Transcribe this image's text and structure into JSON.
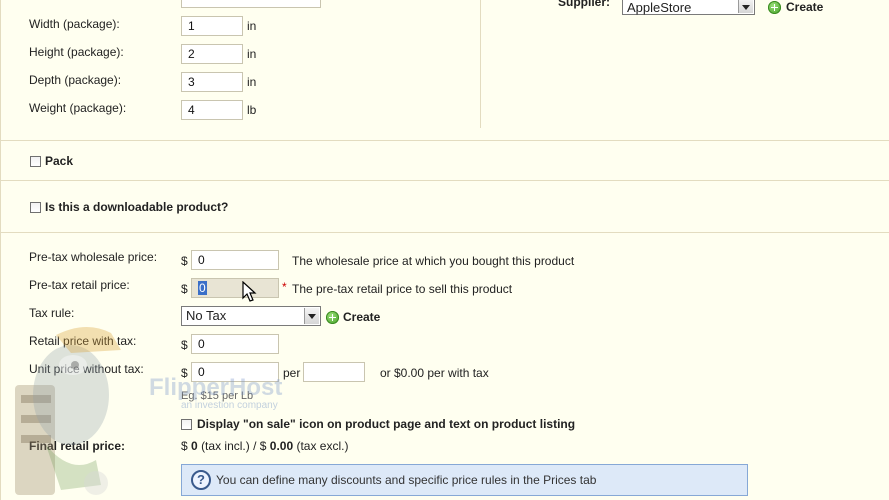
{
  "package": {
    "width_label": "Width (package):",
    "width_value": "1",
    "width_unit": "in",
    "height_label": "Height (package):",
    "height_value": "2",
    "height_unit": "in",
    "depth_label": "Depth (package):",
    "depth_value": "3",
    "depth_unit": "in",
    "weight_label": "Weight (package):",
    "weight_value": "4",
    "weight_unit": "lb"
  },
  "supplier": {
    "label": "Supplier:",
    "selected": "AppleStore",
    "create_label": "Create"
  },
  "pack": {
    "label": "Pack"
  },
  "downloadable": {
    "label": "Is this a downloadable product?"
  },
  "prices": {
    "wholesale_label": "Pre-tax wholesale price:",
    "wholesale_currency": "$",
    "wholesale_value": "0",
    "wholesale_hint": "The wholesale price at which you bought this product",
    "retail_label": "Pre-tax retail price:",
    "retail_currency": "$",
    "retail_value": "0",
    "retail_required": "*",
    "retail_hint": "The pre-tax retail price to sell this product",
    "tax_label": "Tax rule:",
    "tax_selected": "No Tax",
    "tax_create_label": "Create",
    "retail_tax_label": "Retail price with tax:",
    "retail_tax_currency": "$",
    "retail_tax_value": "0",
    "unit_label": "Unit price without tax:",
    "unit_currency": "$",
    "unit_value": "0",
    "unit_per": "per",
    "unit_per_value": "",
    "unit_with_tax": "or $0.00 per with tax",
    "unit_example": "Eg. $15 per Lb",
    "on_sale_label": "Display \"on sale\" icon on product page and text on product listing",
    "final_label": "Final retail price:",
    "final_prefix": "$",
    "final_incl_value": "0",
    "final_incl_text": "(tax incl.) / $",
    "final_excl_value": "0.00",
    "final_excl_text": "(tax excl.)"
  },
  "info": {
    "icon": "question-icon",
    "text": "You can define many discounts and specific price rules in the Prices tab"
  },
  "watermark": {
    "brand": "FlipperHost",
    "tagline": "an investion company"
  },
  "colors": {
    "panel_bg": "#fffff0",
    "border": "#e3dcc0",
    "info_bg": "#dde9f8",
    "info_border": "#86a8d6",
    "accent_green": "#3c9a1e",
    "required": "#cc0000"
  }
}
